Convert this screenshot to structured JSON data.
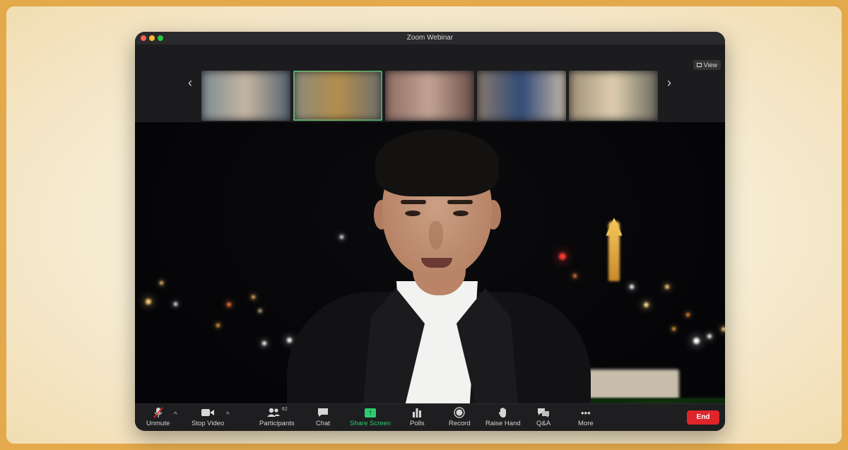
{
  "window": {
    "title": "Zoom Webinar"
  },
  "strip": {
    "view_label": "View",
    "thumbnails": [
      {
        "colors": [
          "#7b8a92",
          "#c7b7a2",
          "#556270"
        ]
      },
      {
        "colors": [
          "#8b8a7c",
          "#b58e4c",
          "#6c6f6b"
        ]
      },
      {
        "colors": [
          "#8e6c64",
          "#c4a494",
          "#6a4f4a"
        ]
      },
      {
        "colors": [
          "#8a7a6c",
          "#2f4a78",
          "#c8b9a6"
        ]
      },
      {
        "colors": [
          "#9d8f76",
          "#e0cfb0",
          "#6a6a5e"
        ]
      }
    ],
    "active_index": 1
  },
  "toolbar": {
    "unmute": "Unmute",
    "stop_video": "Stop Video",
    "participants": "Participants",
    "participant_count": "62",
    "chat": "Chat",
    "share_screen": "Share Screen",
    "polls": "Polls",
    "record": "Record",
    "raise_hand": "Raise Hand",
    "qa": "Q&A",
    "more": "More",
    "end": "End"
  },
  "colors": {
    "accent_green": "#2ecc71",
    "end_red": "#e0252a",
    "frame_gold": "#e3a94b"
  }
}
